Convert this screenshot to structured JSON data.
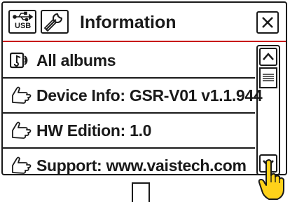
{
  "header": {
    "title": "Information",
    "usb_label": "USB"
  },
  "menu": {
    "items": [
      {
        "label": "All albums",
        "icon": "music-note-icon"
      },
      {
        "label": "Device Info: GSR-V01  v1.1.944",
        "icon": "hand-pointer-icon"
      },
      {
        "label": "HW Edition: 1.0",
        "icon": "hand-pointer-icon"
      },
      {
        "label": "Support: www.vaistech.com",
        "icon": "hand-pointer-icon"
      }
    ]
  },
  "colors": {
    "accent_line": "#c81414",
    "hand_fill": "#ffd21a",
    "ink": "#1a1a1a"
  }
}
